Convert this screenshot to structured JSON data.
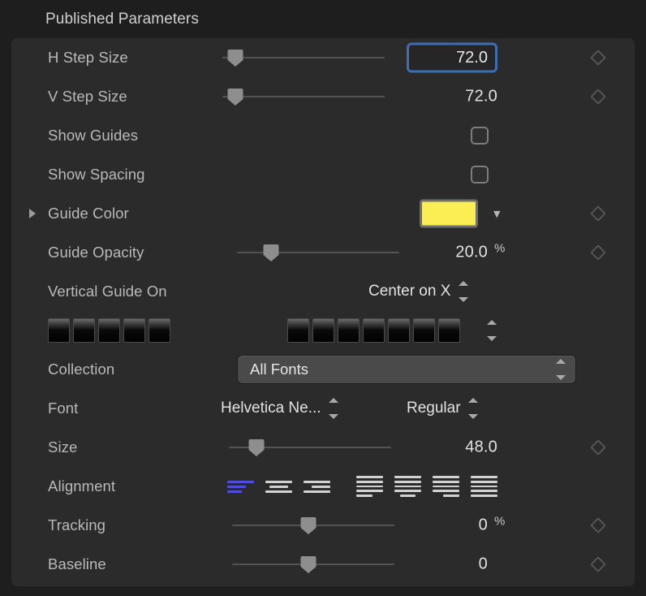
{
  "header": {
    "title": "Published Parameters"
  },
  "colors": {
    "accent_focus_ring": "#3c6eb4",
    "guide_color_swatch": "#FAEE54",
    "alignment_selected": "#4d4de0",
    "panel_background": "#2b2b2b",
    "window_background": "#1e1e1e"
  },
  "rows": [
    {
      "label": "H Step Size",
      "type": "slider-value",
      "value": "72.0",
      "unit": "",
      "thumb_percent": 8,
      "focused": true,
      "keyframe": true
    },
    {
      "label": "V Step Size",
      "type": "slider-value",
      "value": "72.0",
      "unit": "",
      "thumb_percent": 8,
      "focused": false,
      "keyframe": true
    },
    {
      "label": "Show Guides",
      "type": "checkbox",
      "checked": false,
      "keyframe": false
    },
    {
      "label": "Show Spacing",
      "type": "checkbox",
      "checked": false,
      "keyframe": false
    },
    {
      "label": "Guide Color",
      "type": "color",
      "swatch": "#FAEE54",
      "disclosure": true,
      "keyframe": true
    },
    {
      "label": "Guide Opacity",
      "type": "slider-value",
      "value": "20.0",
      "unit": "%",
      "thumb_percent": 21,
      "focused": false,
      "keyframe": true
    },
    {
      "label": "Vertical Guide On",
      "type": "inline-popup",
      "value": "Center on X",
      "keyframe": false
    },
    {
      "label": "",
      "type": "glyph-boxes",
      "left_glyph_count": 5,
      "right_glyph_count": 7,
      "keyframe": false
    },
    {
      "label": "Collection",
      "type": "popup-button",
      "value": "All Fonts",
      "keyframe": false
    },
    {
      "label": "Font",
      "type": "double-inline-popup",
      "value": "Helvetica Ne...",
      "value2": "Regular",
      "keyframe": false
    },
    {
      "label": "Size",
      "type": "slider-value",
      "value": "48.0",
      "unit": "",
      "thumb_percent": 17,
      "focused": false,
      "keyframe": true
    },
    {
      "label": "Alignment",
      "type": "alignment",
      "selected_index": 0,
      "keyframe": false
    },
    {
      "label": "Tracking",
      "type": "slider-value",
      "value": "0",
      "unit": "%",
      "thumb_percent": 47,
      "focused": false,
      "keyframe": true
    },
    {
      "label": "Baseline",
      "type": "slider-value",
      "value": "0",
      "unit": "",
      "thumb_percent": 47,
      "focused": false,
      "keyframe": true
    }
  ],
  "alignment_options": [
    {
      "name": "align-left-icon",
      "lines": 3,
      "widths": [
        "w100",
        "w70",
        "w55"
      ]
    },
    {
      "name": "align-center-icon",
      "lines": 3,
      "widths": [
        "w100",
        "w70",
        "w100"
      ]
    },
    {
      "name": "align-right-icon",
      "lines": 3,
      "widths": [
        "w100",
        "w70",
        "w100"
      ]
    },
    {
      "name": "justify-left-icon",
      "lines": 5,
      "widths": [
        "w100",
        "w100",
        "w100",
        "w100",
        "w60"
      ]
    },
    {
      "name": "justify-center-icon",
      "lines": 5,
      "widths": [
        "w100",
        "w100",
        "w100",
        "w100",
        "w60"
      ]
    },
    {
      "name": "justify-right-icon",
      "lines": 5,
      "widths": [
        "w100",
        "w100",
        "w100",
        "w100",
        "w60"
      ]
    },
    {
      "name": "justify-full-icon",
      "lines": 5,
      "widths": [
        "w100",
        "w100",
        "w100",
        "w100",
        "w100"
      ]
    }
  ]
}
